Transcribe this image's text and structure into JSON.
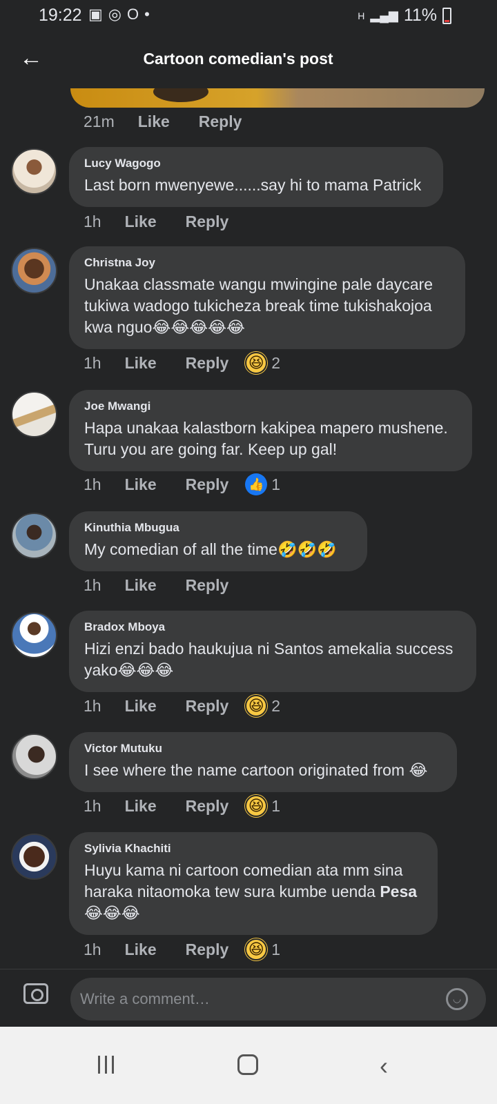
{
  "status_bar": {
    "time": "19:22",
    "battery": "11%",
    "network": "H"
  },
  "header": {
    "title": "Cartoon comedian's post"
  },
  "previous_comment_meta": {
    "time": "21m",
    "like": "Like",
    "reply": "Reply"
  },
  "comments": [
    {
      "author": "Lucy Wagogo",
      "text": "Last born mwenyewe......say hi to mama Patrick",
      "time": "1h",
      "like": "Like",
      "reply": "Reply",
      "reaction": "",
      "reaction_count": ""
    },
    {
      "author": "Christna Joy",
      "text": "Unakaa classmate wangu  mwingine pale daycare tukiwa wadogo  tukicheza break time tukishakojoa kwa nguo😂😂😂😂😂",
      "time": "1h",
      "like": "Like",
      "reply": "Reply",
      "reaction": "haha",
      "reaction_count": "2"
    },
    {
      "author": "Joe Mwangi",
      "text": "Hapa unakaa kalastborn kakipea mapero mushene. Turu you are going far. Keep up gal!",
      "time": "1h",
      "like": "Like",
      "reply": "Reply",
      "reaction": "like",
      "reaction_count": "1"
    },
    {
      "author": "Kinuthia Mbugua",
      "text": "My comedian of all the time🤣🤣🤣",
      "time": "1h",
      "like": "Like",
      "reply": "Reply",
      "reaction": "",
      "reaction_count": ""
    },
    {
      "author": "Bradox Mboya",
      "text": "Hizi enzi bado haukujua ni Santos amekalia success yako😂😂😂",
      "time": "1h",
      "like": "Like",
      "reply": "Reply",
      "reaction": "haha",
      "reaction_count": "2"
    },
    {
      "author": "Victor Mutuku",
      "text": "I see where the name cartoon originated from 😂",
      "time": "1h",
      "like": "Like",
      "reply": "Reply",
      "reaction": "haha",
      "reaction_count": "1"
    },
    {
      "author": "Sylivia Khachiti",
      "text_before": "Huyu kama ni cartoon comedian ata mm sina haraka nitaomoka tew sura kumbe uenda ",
      "text_bold": "Pesa",
      "text_after": " 😂😂😂",
      "time": "1h",
      "like": "Like",
      "reply": "Reply",
      "reaction": "haha",
      "reaction_count": "1"
    }
  ],
  "composer": {
    "placeholder": "Write a comment…"
  },
  "colors": {
    "background": "#242526",
    "bubble": "#3a3b3c",
    "meta": "#b0b3b8",
    "like_blue": "#1877f2",
    "haha_yellow": "#f7c843"
  }
}
